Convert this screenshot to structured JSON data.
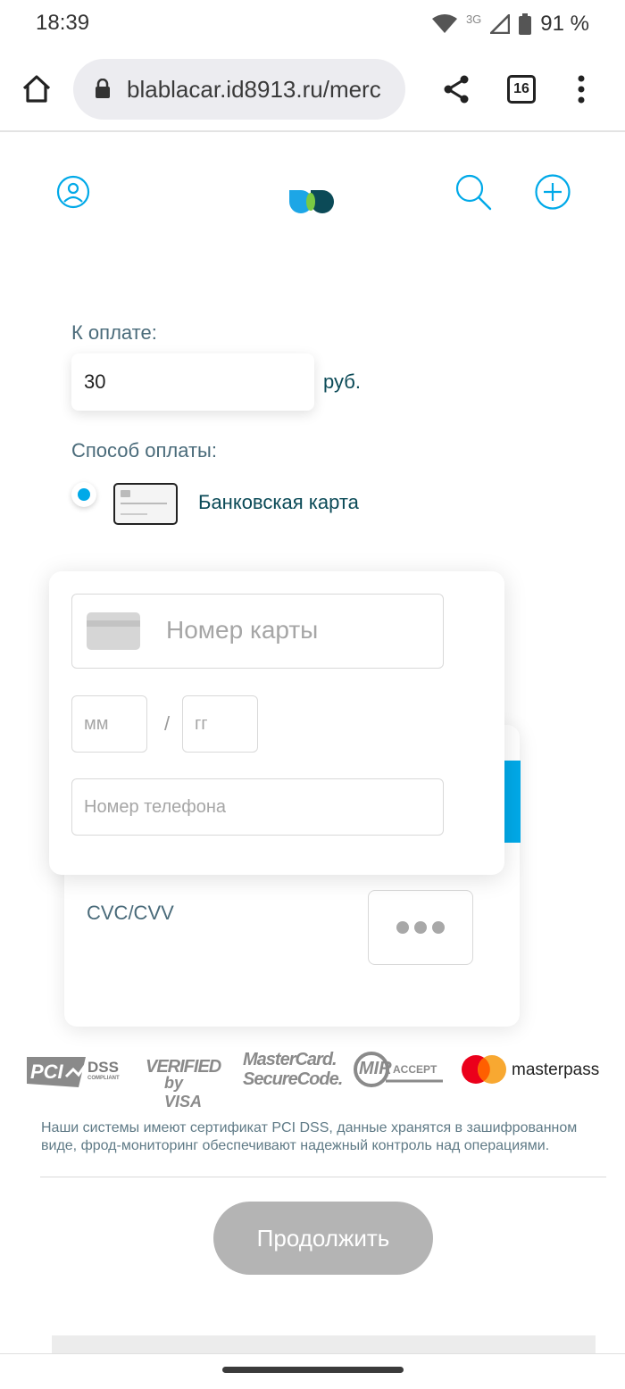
{
  "status_bar": {
    "time": "18:39",
    "network": "3G",
    "battery": "91 %"
  },
  "browser": {
    "url": "blablacar.id8913.ru/merc",
    "tabs_count": "16"
  },
  "payment": {
    "amount_label": "К оплате:",
    "amount_value": "30",
    "currency": "руб.",
    "method_label": "Способ оплаты:",
    "method_option": "Банковская карта"
  },
  "card_form": {
    "card_number_placeholder": "Номер карты",
    "month_placeholder": "мм",
    "separator": "/",
    "year_placeholder": "гг",
    "phone_placeholder": "Номер телефона",
    "cvc_label": "CVC/CVV"
  },
  "logos": {
    "pci": "PCI",
    "dss": "DSS",
    "compliant": "COMPLIANT",
    "verified": "VERIFIED",
    "by_visa": "by VISA",
    "mastercard": "MasterCard.",
    "securecode": "SecureCode.",
    "mir": "MIR",
    "accept": "ACCEPT",
    "masterpass": "masterpass"
  },
  "notice": "Наши системы имеют сертификат PCI DSS, данные хранятся в зашифрованном виде, фрод-мониторинг обеспечивают надежный контроль над операциями.",
  "continue_button": "Продолжить",
  "colors": {
    "accent": "#00a9e8",
    "brand_dark": "#0b4a57",
    "button_disabled": "#b4b4b4"
  }
}
